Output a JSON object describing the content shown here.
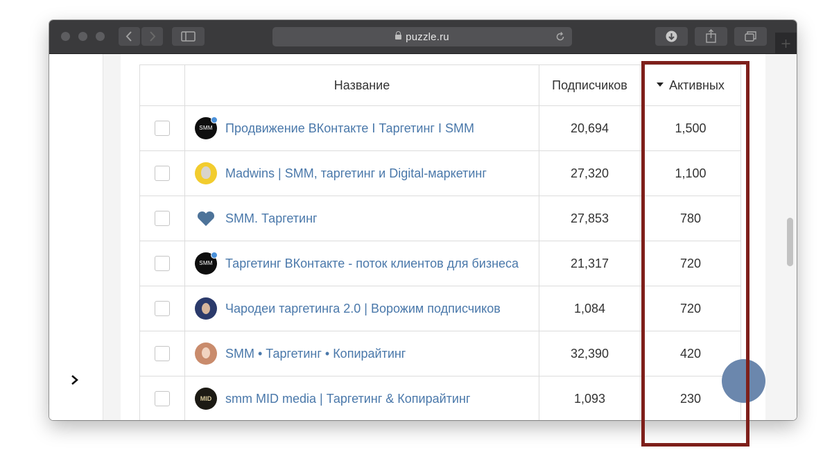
{
  "browser": {
    "url": "puzzle.ru"
  },
  "table": {
    "columns": {
      "name": "Название",
      "subscribers": "Подписчиков",
      "active": "Активных"
    },
    "rows": [
      {
        "name": "Продвижение ВКонтакте I Таргетинг I SMM",
        "subscribers": "20,694",
        "active": "1,500",
        "avatar_text": "SMM"
      },
      {
        "name": "Madwins | SMM, таргетинг и Digital-маркетинг",
        "subscribers": "27,320",
        "active": "1,100",
        "avatar_text": ""
      },
      {
        "name": "SMM. Таргетинг",
        "subscribers": "27,853",
        "active": "780",
        "avatar_text": ""
      },
      {
        "name": "Таргетинг ВКонтакте - поток клиентов для бизнеса",
        "subscribers": "21,317",
        "active": "720",
        "avatar_text": "SMM"
      },
      {
        "name": "Чародеи таргетинга 2.0 | Ворожим подписчиков",
        "subscribers": "1,084",
        "active": "720",
        "avatar_text": ""
      },
      {
        "name": "SMM • Таргетинг • Копирайтинг",
        "subscribers": "32,390",
        "active": "420",
        "avatar_text": ""
      },
      {
        "name": "smm MID media | Таргетинг & Копирайтинг",
        "subscribers": "1,093",
        "active": "230",
        "avatar_text": "MID"
      }
    ]
  },
  "colors": {
    "link": "#4a78aa",
    "highlight": "#7e1f1a",
    "bubble": "#6b87ad"
  },
  "icons": [
    "back-arrow-icon",
    "forward-arrow-icon",
    "sidebar-icon",
    "lock-icon",
    "reload-icon",
    "download-icon",
    "share-icon",
    "tabs-icon",
    "chevron-right-icon",
    "heart-icon"
  ]
}
